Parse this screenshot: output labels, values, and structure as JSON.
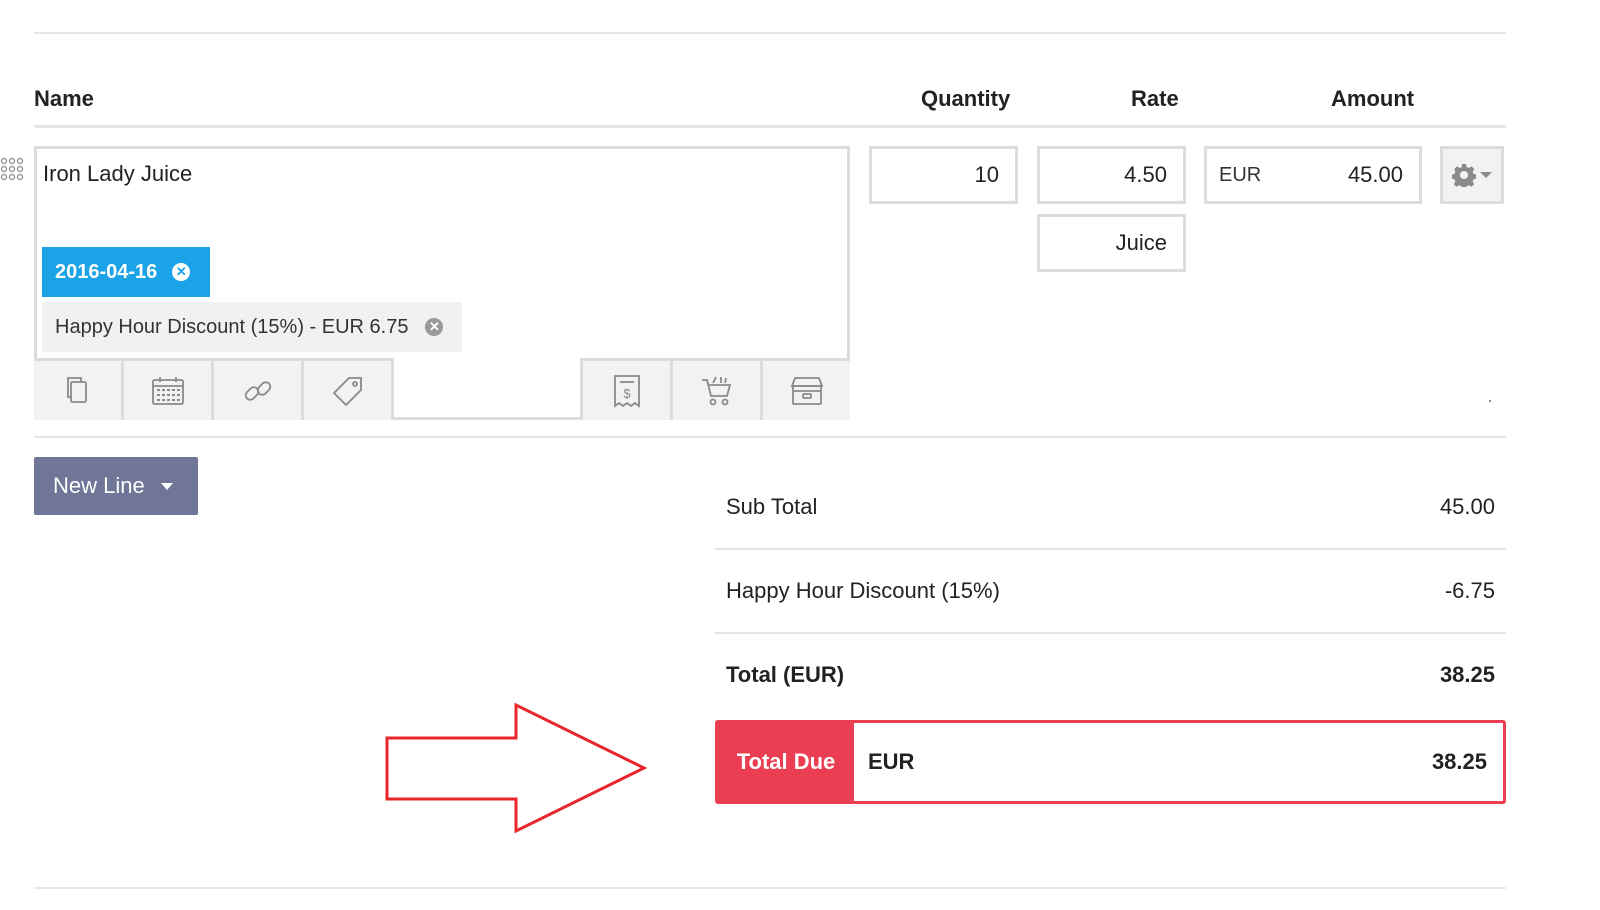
{
  "columns": {
    "name": "Name",
    "quantity": "Quantity",
    "rate": "Rate",
    "amount": "Amount"
  },
  "line_item": {
    "name": "Iron Lady Juice",
    "date_tag": "2016-04-16",
    "discount_tag": "Happy Hour Discount (15%) - EUR 6.75",
    "quantity": "10",
    "rate": "4.50",
    "unit": "Juice",
    "amount_currency": "EUR",
    "amount": "45.00"
  },
  "toolbar_icons": [
    "copy-icon",
    "calendar-icon",
    "link-icon",
    "tag-icon",
    "receipt-icon",
    "cart-icon",
    "archive-icon"
  ],
  "new_line_button": "New Line",
  "summary": {
    "subtotal_label": "Sub Total",
    "subtotal_value": "45.00",
    "discount_label": "Happy Hour Discount (15%)",
    "discount_value": "-6.75",
    "total_label": "Total (EUR)",
    "total_value": "38.25"
  },
  "total_due": {
    "label": "Total Due",
    "currency": "EUR",
    "value": "38.25"
  },
  "colors": {
    "accent_blue": "#1aa3e6",
    "button_slate": "#6f7697",
    "due_red": "#ec3e52",
    "arrow_red": "#e8262c"
  }
}
